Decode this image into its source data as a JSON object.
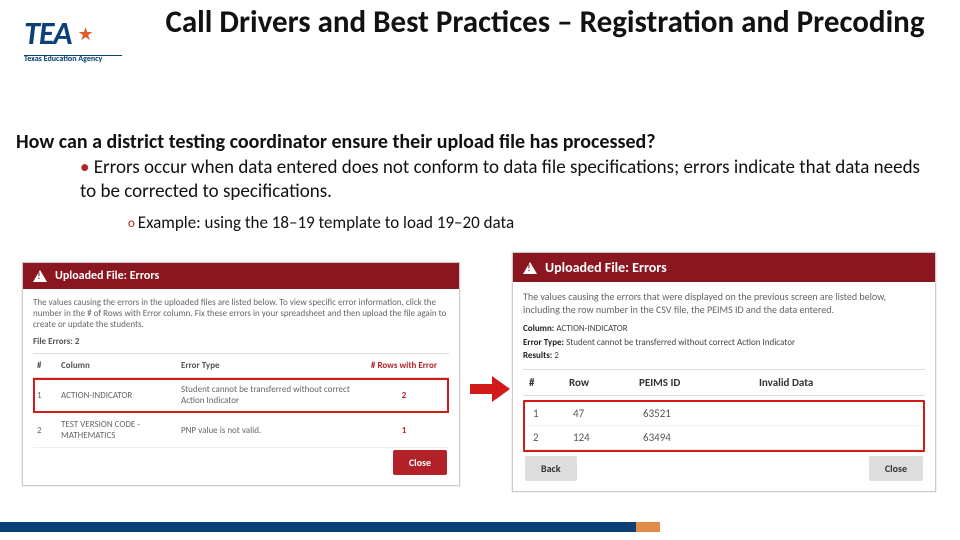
{
  "logo": {
    "word": "TEA",
    "sub": "Texas Education Agency"
  },
  "title": "Call Drivers and Best Practices – Registration and Precoding",
  "question": "How can a district testing coordinator ensure their upload file has processed?",
  "bullet1": "Errors occur when data entered does not conform to data file specifications; errors indicate that data needs to be corrected to specifications.",
  "bullet2": "Example:  using the 18–19 template to load 19–20 data",
  "left_panel": {
    "header": "Uploaded File: Errors",
    "desc": "The values causing the errors in the uploaded files are listed below. To view specific error information, click the number in the # of Rows with Error column. Fix these errors in your spreadsheet and then upload the file again to create or update the students.",
    "file_errors_label": "File Errors: 2",
    "cols": {
      "num": "#",
      "column": "Column",
      "type": "Error Type",
      "rows": "# Rows with Error"
    },
    "rows": [
      {
        "n": "1",
        "col": "ACTION-INDICATOR",
        "type": "Student cannot be transferred without correct Action Indicator",
        "rows": "2",
        "hl": true
      },
      {
        "n": "2",
        "col": "TEST VERSION CODE - MATHEMATICS",
        "type": "PNP value is not valid.",
        "rows": "1",
        "hl": false
      }
    ],
    "close": "Close"
  },
  "right_panel": {
    "header": "Uploaded File: Errors",
    "desc": "The values causing the errors that were displayed on the previous screen are listed below, including the row number in the CSV file, the PEIMS ID and the data entered.",
    "meta": {
      "column_label": "Column:",
      "column_val": "ACTION-INDICATOR",
      "type_label": "Error Type:",
      "type_val": "Student cannot be transferred without correct Action Indicator",
      "results_label": "Results:",
      "results_val": "2"
    },
    "cols": {
      "num": "#",
      "row": "Row",
      "peims": "PEIMS ID",
      "invalid": "Invalid Data"
    },
    "rows": [
      {
        "n": "1",
        "row": "47",
        "peims": "63521",
        "invalid": ""
      },
      {
        "n": "2",
        "row": "124",
        "peims": "63494",
        "invalid": ""
      }
    ],
    "back": "Back",
    "close": "Close"
  }
}
